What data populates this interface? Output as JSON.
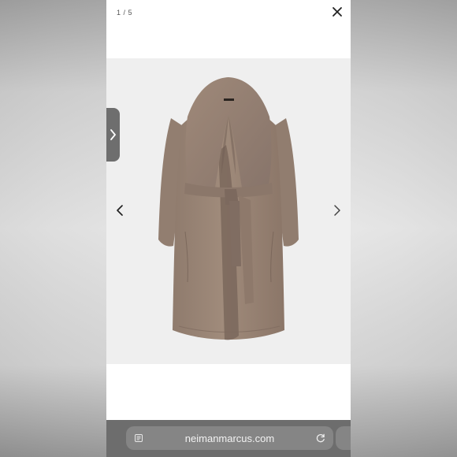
{
  "gallery": {
    "counter": "1 / 5",
    "close_icon": "close-icon",
    "prev_icon": "chevron-left-icon",
    "next_icon": "chevron-right-icon",
    "product_image_subject": "long shawl-collar belted wrap coat"
  },
  "browser": {
    "url": "neimanmarcus.com",
    "reader_icon": "reader-mode-icon",
    "reload_icon": "reload-icon"
  },
  "colors": {
    "coat": "#9d8878",
    "coat_dark": "#7f6d60",
    "coat_light": "#b09a89",
    "product_background": "#efefef",
    "browser_bar": "#6d6d6d"
  }
}
